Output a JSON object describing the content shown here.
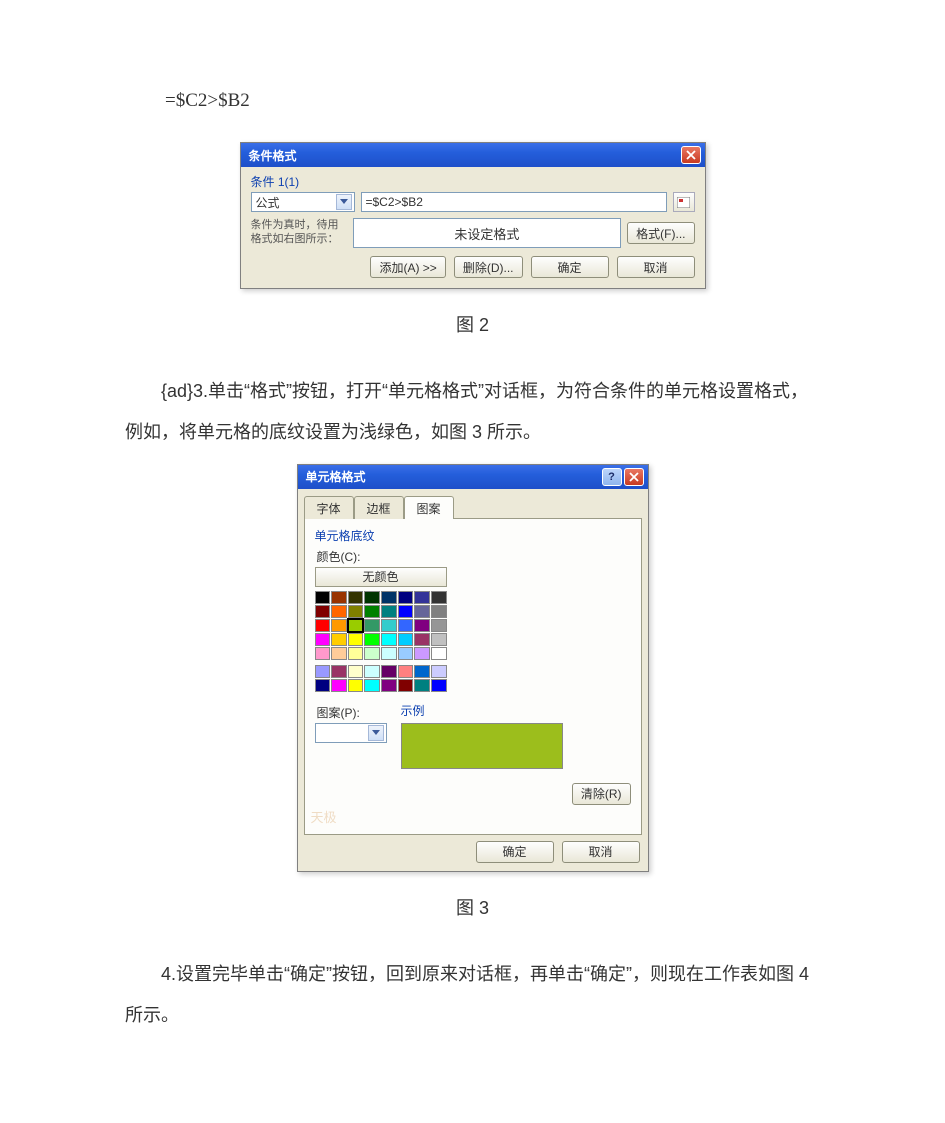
{
  "formula": "=$C2>$B2",
  "dlg1": {
    "title": "条件格式",
    "condition_label": "条件 1(1)",
    "type": "公式",
    "formula_value": "=$C2>$B2",
    "hint": "条件为真时，待用格式如右图所示：",
    "preview": "未设定格式",
    "format_btn": "格式(F)...",
    "add_btn": "添加(A) >>",
    "del_btn": "删除(D)...",
    "ok_btn": "确定",
    "cancel_btn": "取消"
  },
  "captions": {
    "fig2": "图 2",
    "fig3": "图 3"
  },
  "paragraphs": {
    "p3": "{ad}3.单击“格式”按钮，打开“单元格格式”对话框，为符合条件的单元格设置格式，例如，将单元格的底纹设置为浅绿色，如图 3 所示。",
    "p4": "4.设置完毕单击“确定”按钮，回到原来对话框，再单击“确定”，则现在工作表如图 4 所示。"
  },
  "dlg2": {
    "title": "单元格格式",
    "tabs": [
      "字体",
      "边框",
      "图案"
    ],
    "shading_group": "单元格底纹",
    "color_label": "颜色(C):",
    "no_color": "无颜色",
    "pattern_label": "图案(P):",
    "sample_label": "示例",
    "clear_btn": "清除(R)",
    "ok_btn": "确定",
    "cancel_btn": "取消",
    "watermark": "天极",
    "selected_color": "#99cc00",
    "palette_top": [
      [
        "#000000",
        "#993300",
        "#333300",
        "#003300",
        "#003366",
        "#000080",
        "#333399",
        "#333333"
      ],
      [
        "#800000",
        "#ff6600",
        "#808000",
        "#008000",
        "#008080",
        "#0000ff",
        "#666699",
        "#808080"
      ],
      [
        "#ff0000",
        "#ff9900",
        "#99cc00",
        "#339966",
        "#33cccc",
        "#3366ff",
        "#800080",
        "#969696"
      ],
      [
        "#ff00ff",
        "#ffcc00",
        "#ffff00",
        "#00ff00",
        "#00ffff",
        "#00ccff",
        "#993366",
        "#c0c0c0"
      ],
      [
        "#ff99cc",
        "#ffcc99",
        "#ffff99",
        "#ccffcc",
        "#ccffff",
        "#99ccff",
        "#cc99ff",
        "#ffffff"
      ]
    ],
    "palette_bottom": [
      [
        "#9999ff",
        "#993366",
        "#ffffcc",
        "#ccffff",
        "#660066",
        "#ff8080",
        "#0066cc",
        "#ccccff"
      ],
      [
        "#000080",
        "#ff00ff",
        "#ffff00",
        "#00ffff",
        "#800080",
        "#800000",
        "#008080",
        "#0000ff"
      ]
    ]
  }
}
